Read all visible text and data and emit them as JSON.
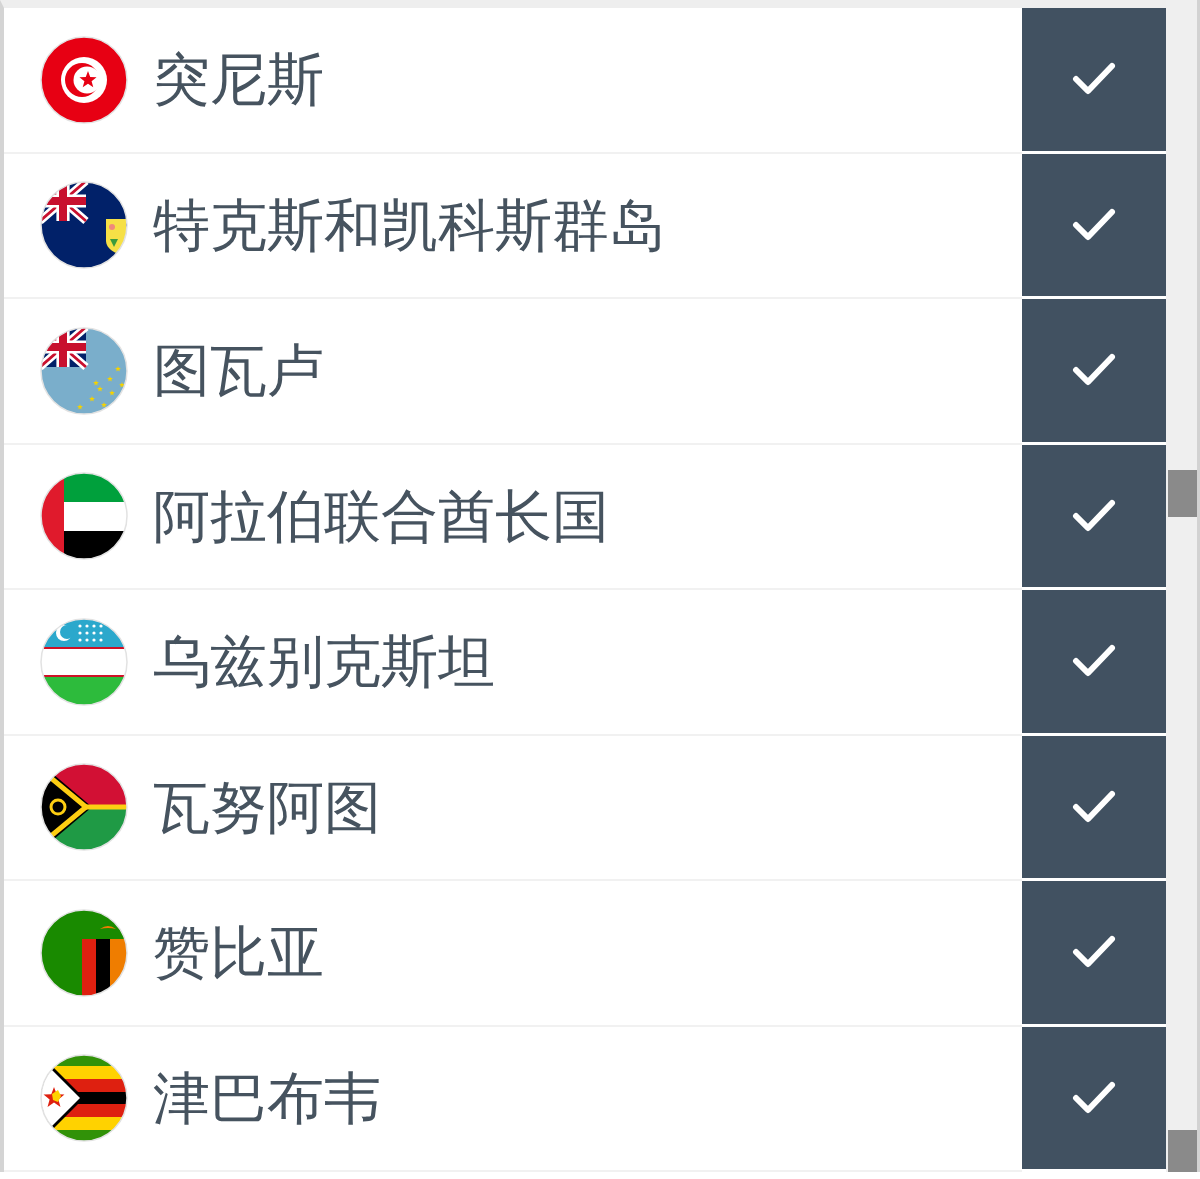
{
  "countries": [
    {
      "name": "突尼斯",
      "checked": true
    },
    {
      "name": "特克斯和凯科斯群岛",
      "checked": true
    },
    {
      "name": "图瓦卢",
      "checked": true
    },
    {
      "name": "阿拉伯联合酋长国",
      "checked": true
    },
    {
      "name": "乌兹别克斯坦",
      "checked": true
    },
    {
      "name": "瓦努阿图",
      "checked": true
    },
    {
      "name": "赞比亚",
      "checked": true
    },
    {
      "name": "津巴布韦",
      "checked": true
    }
  ]
}
